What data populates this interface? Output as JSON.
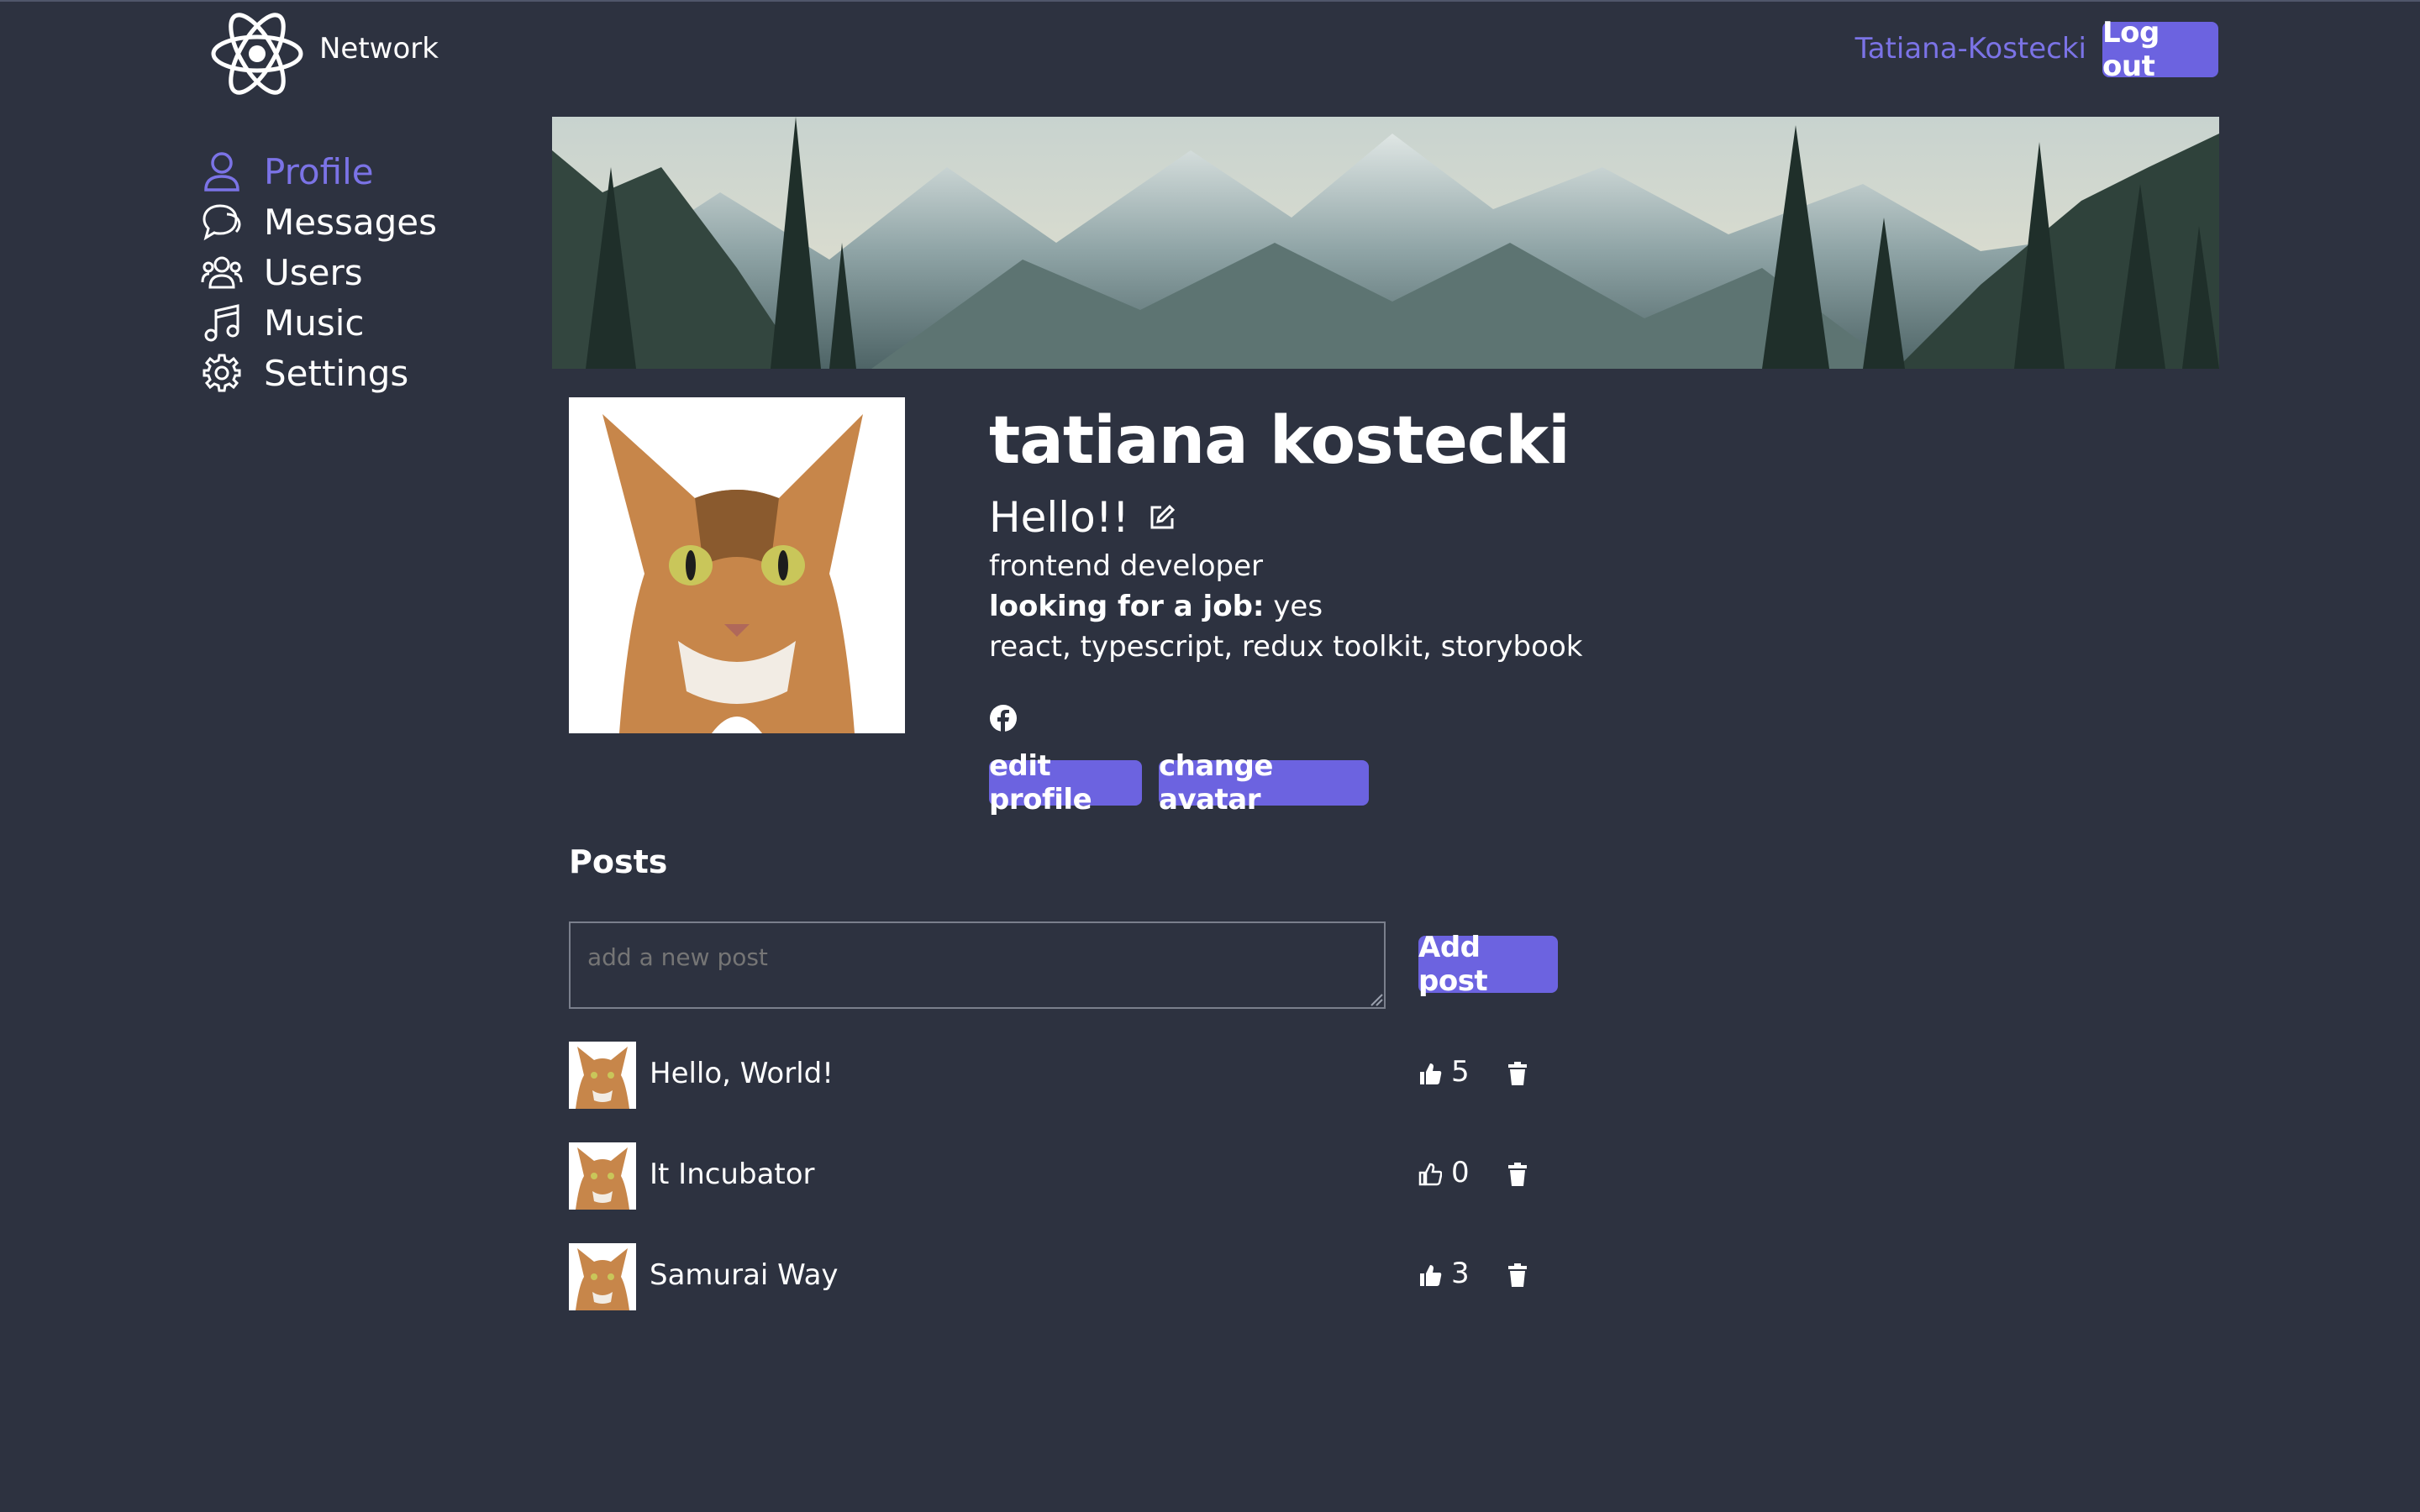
{
  "header": {
    "brand": "Network",
    "username": "Tatiana-Kostecki",
    "logout_label": "Log out"
  },
  "sidebar": {
    "items": [
      {
        "label": "Profile",
        "icon": "user-icon",
        "active": true
      },
      {
        "label": "Messages",
        "icon": "chat-icon",
        "active": false
      },
      {
        "label": "Users",
        "icon": "users-icon",
        "active": false
      },
      {
        "label": "Music",
        "icon": "music-icon",
        "active": false
      },
      {
        "label": "Settings",
        "icon": "gear-icon",
        "active": false
      }
    ]
  },
  "profile": {
    "full_name": "tatiana kostecki",
    "status": "Hello!!",
    "about": "frontend developer",
    "job_label": "looking for a job:",
    "job_value": "yes",
    "skills": "react, typescript, redux toolkit, storybook",
    "edit_profile_label": "edit profile",
    "change_avatar_label": "change avatar"
  },
  "posts": {
    "title": "Posts",
    "input_placeholder": "add a new post",
    "add_label": "Add post",
    "items": [
      {
        "text": "Hello, World!",
        "likes": "5",
        "liked": true
      },
      {
        "text": "It Incubator",
        "likes": "0",
        "liked": false
      },
      {
        "text": "Samurai Way",
        "likes": "3",
        "liked": true
      }
    ]
  },
  "colors": {
    "background": "#2d3240",
    "accent": "#6c63e0",
    "accent_text": "#7b73e6"
  }
}
